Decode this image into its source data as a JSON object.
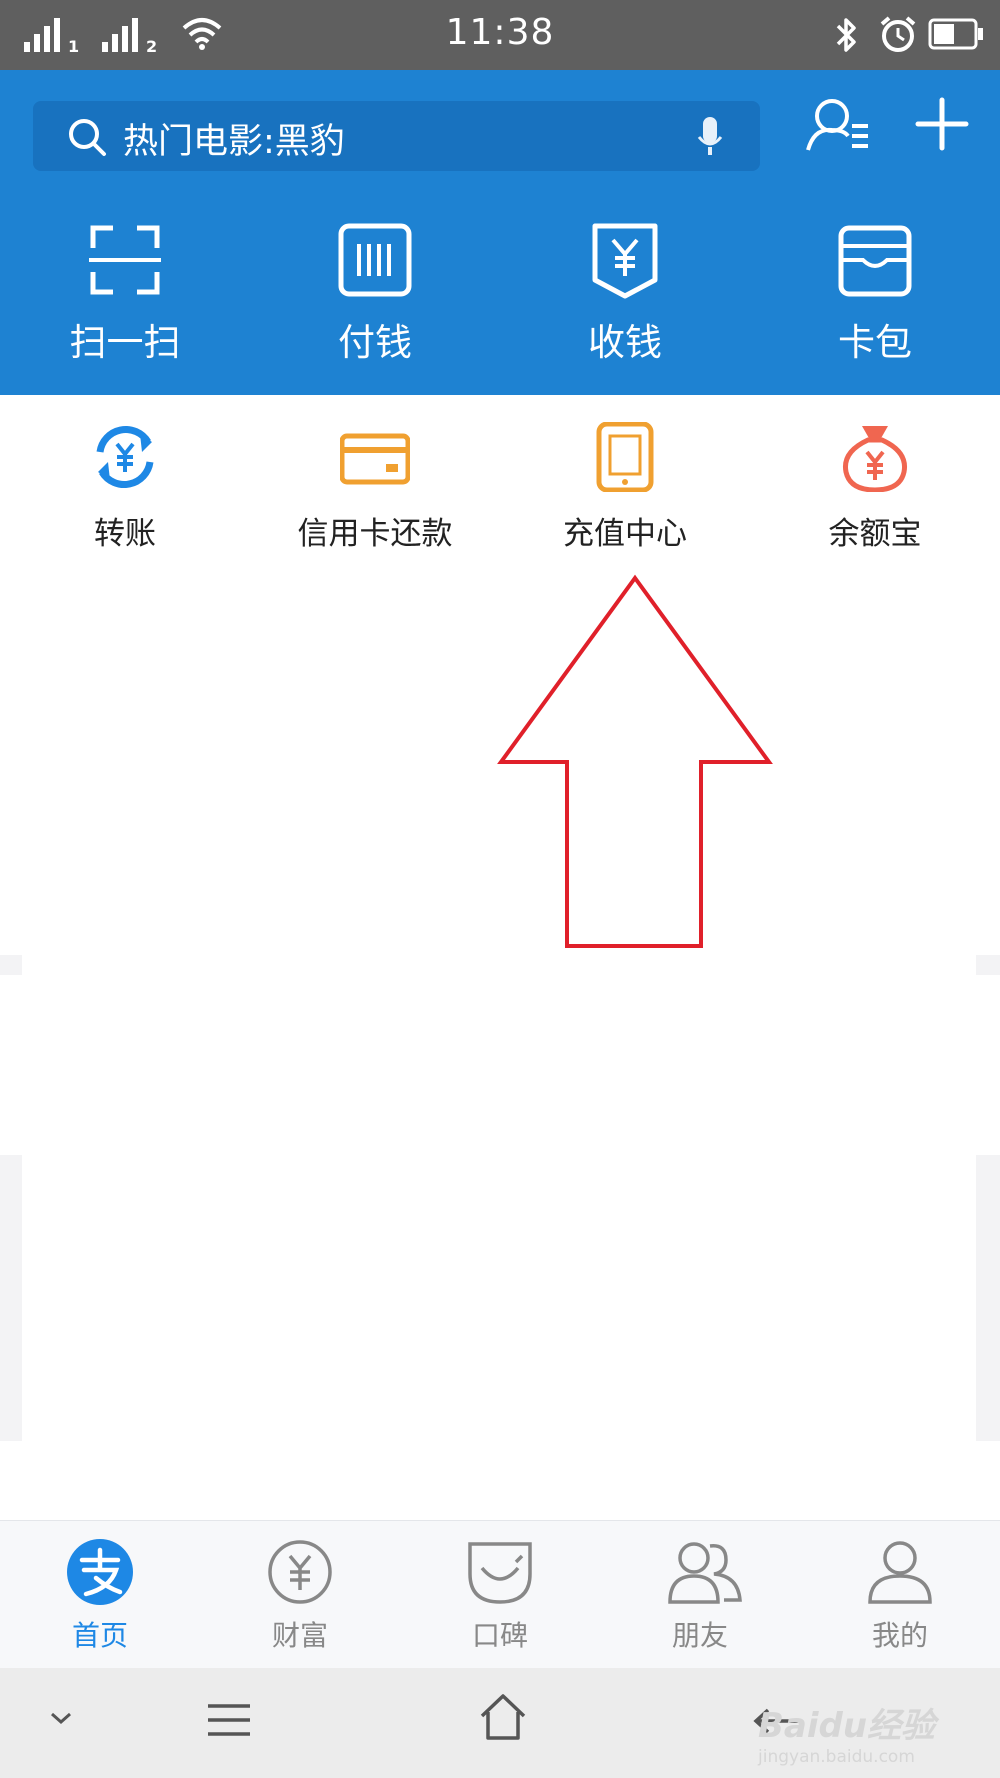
{
  "status_bar": {
    "time": "11:38",
    "sim1": "1",
    "sim2": "2",
    "icons": [
      "signal-icon",
      "wifi-icon",
      "bluetooth-icon",
      "alarm-icon",
      "battery-icon"
    ]
  },
  "search": {
    "placeholder": "热门电影:黑豹",
    "icons": [
      "search-icon",
      "mic-icon"
    ]
  },
  "header_actions": [
    "contacts-icon",
    "add-icon"
  ],
  "quick_actions": [
    {
      "label": "扫一扫",
      "icon": "scan-icon"
    },
    {
      "label": "付钱",
      "icon": "pay-barcode-icon"
    },
    {
      "label": "收钱",
      "icon": "receive-money-icon"
    },
    {
      "label": "卡包",
      "icon": "card-wallet-icon"
    }
  ],
  "services": [
    {
      "label": "转账",
      "icon": "transfer-icon",
      "color": "#1e88e5"
    },
    {
      "label": "信用卡还款",
      "icon": "credit-card-icon",
      "color": "#f0a030"
    },
    {
      "label": "充值中心",
      "icon": "phone-topup-icon",
      "color": "#f0a030"
    },
    {
      "label": "余额宝",
      "icon": "money-bag-icon",
      "color": "#f06650"
    }
  ],
  "annotation": {
    "arrow_color": "#e0202a"
  },
  "tabs": [
    {
      "label": "首页",
      "icon": "alipay-home-icon",
      "active": true
    },
    {
      "label": "财富",
      "icon": "wealth-icon",
      "active": false
    },
    {
      "label": "口碑",
      "icon": "koubei-icon",
      "active": false
    },
    {
      "label": "朋友",
      "icon": "friends-icon",
      "active": false
    },
    {
      "label": "我的",
      "icon": "profile-icon",
      "active": false
    }
  ],
  "colors": {
    "brand_blue": "#1e82d2",
    "search_bg": "#1872bf",
    "tab_active": "#1e88e5"
  },
  "watermark": {
    "brand": "Baidu经验",
    "url": "jingyan.baidu.com"
  }
}
